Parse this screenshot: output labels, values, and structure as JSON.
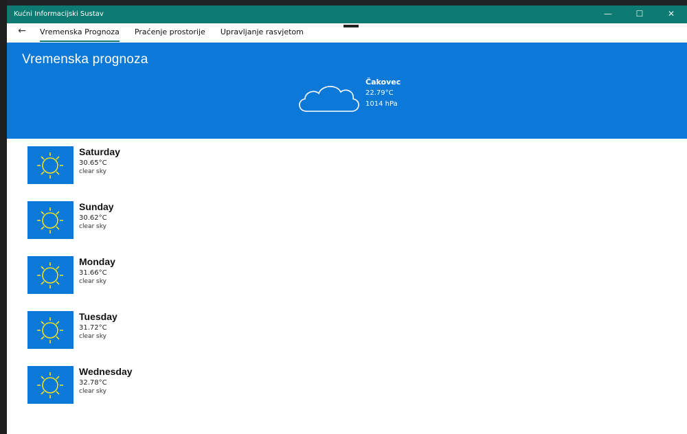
{
  "window": {
    "title": "Kućni Informacijski Sustav",
    "controls": {
      "minimize": "—",
      "maximize": "☐",
      "close": "✕"
    }
  },
  "nav": {
    "back": "←",
    "tabs": [
      {
        "label": "Vremenska Prognoza",
        "active": true
      },
      {
        "label": "Praćenje prostorije",
        "active": false
      },
      {
        "label": "Upravljanje rasvjetom",
        "active": false
      }
    ]
  },
  "hero": {
    "heading": "Vremenska prognoza",
    "current": {
      "city": "Čakovec",
      "temperature": "22.79°C",
      "pressure": "1014 hPa",
      "icon": "cloud-icon"
    }
  },
  "forecast": [
    {
      "day": "Saturday",
      "temperature": "30.65°C",
      "description": "clear sky",
      "icon": "sun-icon"
    },
    {
      "day": "Sunday",
      "temperature": "30.62°C",
      "description": "clear sky",
      "icon": "sun-icon"
    },
    {
      "day": "Monday",
      "temperature": "31.66°C",
      "description": "clear sky",
      "icon": "sun-icon"
    },
    {
      "day": "Tuesday",
      "temperature": "31.72°C",
      "description": "clear sky",
      "icon": "sun-icon"
    },
    {
      "day": "Wednesday",
      "temperature": "32.78°C",
      "description": "clear sky",
      "icon": "sun-icon"
    }
  ],
  "colors": {
    "titlebar": "#0e7b72",
    "accent": "#0c79d9",
    "sun": "#f2e21a"
  }
}
